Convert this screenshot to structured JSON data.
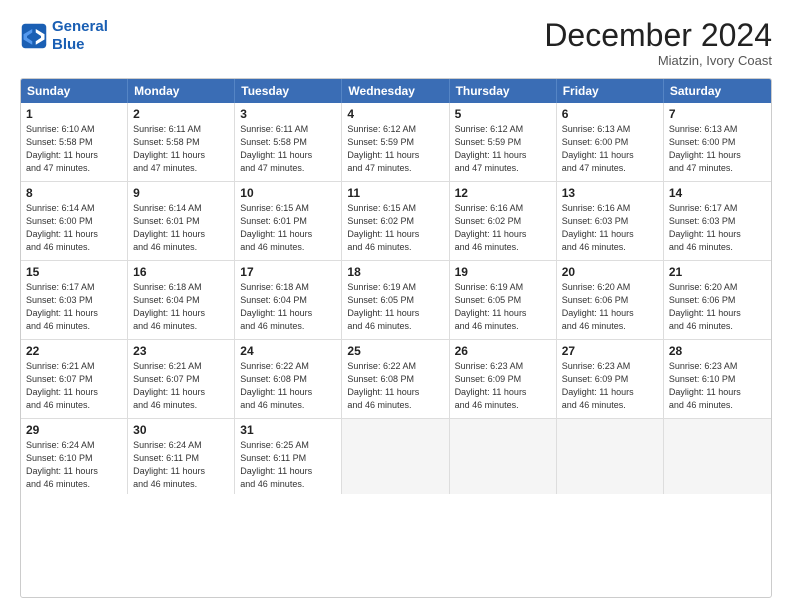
{
  "header": {
    "logo_line1": "General",
    "logo_line2": "Blue",
    "month_title": "December 2024",
    "location": "Miatzin, Ivory Coast"
  },
  "days_of_week": [
    "Sunday",
    "Monday",
    "Tuesday",
    "Wednesday",
    "Thursday",
    "Friday",
    "Saturday"
  ],
  "weeks": [
    [
      {
        "day": "1",
        "info": "Sunrise: 6:10 AM\nSunset: 5:58 PM\nDaylight: 11 hours\nand 47 minutes."
      },
      {
        "day": "2",
        "info": "Sunrise: 6:11 AM\nSunset: 5:58 PM\nDaylight: 11 hours\nand 47 minutes."
      },
      {
        "day": "3",
        "info": "Sunrise: 6:11 AM\nSunset: 5:58 PM\nDaylight: 11 hours\nand 47 minutes."
      },
      {
        "day": "4",
        "info": "Sunrise: 6:12 AM\nSunset: 5:59 PM\nDaylight: 11 hours\nand 47 minutes."
      },
      {
        "day": "5",
        "info": "Sunrise: 6:12 AM\nSunset: 5:59 PM\nDaylight: 11 hours\nand 47 minutes."
      },
      {
        "day": "6",
        "info": "Sunrise: 6:13 AM\nSunset: 6:00 PM\nDaylight: 11 hours\nand 47 minutes."
      },
      {
        "day": "7",
        "info": "Sunrise: 6:13 AM\nSunset: 6:00 PM\nDaylight: 11 hours\nand 47 minutes."
      }
    ],
    [
      {
        "day": "8",
        "info": "Sunrise: 6:14 AM\nSunset: 6:00 PM\nDaylight: 11 hours\nand 46 minutes."
      },
      {
        "day": "9",
        "info": "Sunrise: 6:14 AM\nSunset: 6:01 PM\nDaylight: 11 hours\nand 46 minutes."
      },
      {
        "day": "10",
        "info": "Sunrise: 6:15 AM\nSunset: 6:01 PM\nDaylight: 11 hours\nand 46 minutes."
      },
      {
        "day": "11",
        "info": "Sunrise: 6:15 AM\nSunset: 6:02 PM\nDaylight: 11 hours\nand 46 minutes."
      },
      {
        "day": "12",
        "info": "Sunrise: 6:16 AM\nSunset: 6:02 PM\nDaylight: 11 hours\nand 46 minutes."
      },
      {
        "day": "13",
        "info": "Sunrise: 6:16 AM\nSunset: 6:03 PM\nDaylight: 11 hours\nand 46 minutes."
      },
      {
        "day": "14",
        "info": "Sunrise: 6:17 AM\nSunset: 6:03 PM\nDaylight: 11 hours\nand 46 minutes."
      }
    ],
    [
      {
        "day": "15",
        "info": "Sunrise: 6:17 AM\nSunset: 6:03 PM\nDaylight: 11 hours\nand 46 minutes."
      },
      {
        "day": "16",
        "info": "Sunrise: 6:18 AM\nSunset: 6:04 PM\nDaylight: 11 hours\nand 46 minutes."
      },
      {
        "day": "17",
        "info": "Sunrise: 6:18 AM\nSunset: 6:04 PM\nDaylight: 11 hours\nand 46 minutes."
      },
      {
        "day": "18",
        "info": "Sunrise: 6:19 AM\nSunset: 6:05 PM\nDaylight: 11 hours\nand 46 minutes."
      },
      {
        "day": "19",
        "info": "Sunrise: 6:19 AM\nSunset: 6:05 PM\nDaylight: 11 hours\nand 46 minutes."
      },
      {
        "day": "20",
        "info": "Sunrise: 6:20 AM\nSunset: 6:06 PM\nDaylight: 11 hours\nand 46 minutes."
      },
      {
        "day": "21",
        "info": "Sunrise: 6:20 AM\nSunset: 6:06 PM\nDaylight: 11 hours\nand 46 minutes."
      }
    ],
    [
      {
        "day": "22",
        "info": "Sunrise: 6:21 AM\nSunset: 6:07 PM\nDaylight: 11 hours\nand 46 minutes."
      },
      {
        "day": "23",
        "info": "Sunrise: 6:21 AM\nSunset: 6:07 PM\nDaylight: 11 hours\nand 46 minutes."
      },
      {
        "day": "24",
        "info": "Sunrise: 6:22 AM\nSunset: 6:08 PM\nDaylight: 11 hours\nand 46 minutes."
      },
      {
        "day": "25",
        "info": "Sunrise: 6:22 AM\nSunset: 6:08 PM\nDaylight: 11 hours\nand 46 minutes."
      },
      {
        "day": "26",
        "info": "Sunrise: 6:23 AM\nSunset: 6:09 PM\nDaylight: 11 hours\nand 46 minutes."
      },
      {
        "day": "27",
        "info": "Sunrise: 6:23 AM\nSunset: 6:09 PM\nDaylight: 11 hours\nand 46 minutes."
      },
      {
        "day": "28",
        "info": "Sunrise: 6:23 AM\nSunset: 6:10 PM\nDaylight: 11 hours\nand 46 minutes."
      }
    ],
    [
      {
        "day": "29",
        "info": "Sunrise: 6:24 AM\nSunset: 6:10 PM\nDaylight: 11 hours\nand 46 minutes."
      },
      {
        "day": "30",
        "info": "Sunrise: 6:24 AM\nSunset: 6:11 PM\nDaylight: 11 hours\nand 46 minutes."
      },
      {
        "day": "31",
        "info": "Sunrise: 6:25 AM\nSunset: 6:11 PM\nDaylight: 11 hours\nand 46 minutes."
      },
      {
        "day": "",
        "info": ""
      },
      {
        "day": "",
        "info": ""
      },
      {
        "day": "",
        "info": ""
      },
      {
        "day": "",
        "info": ""
      }
    ]
  ]
}
